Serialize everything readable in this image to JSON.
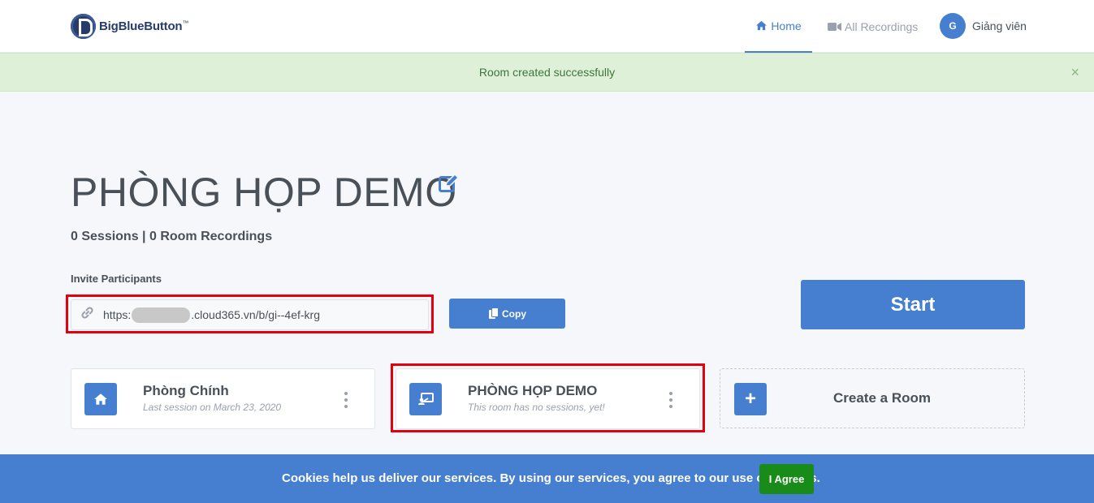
{
  "header": {
    "logo_text": "BigBlueButton",
    "logo_tm": "™",
    "nav": {
      "home_label": "Home",
      "recordings_label": "All Recordings"
    },
    "user": {
      "initial": "G",
      "name": "Giảng viên"
    }
  },
  "alert": {
    "message": "Room created successfully",
    "close": "×"
  },
  "room": {
    "title": "PHÒNG HỌP DEMO",
    "stats": "0 Sessions | 0 Room Recordings",
    "invite_label": "Invite Participants",
    "invite_url_prefix": "https:",
    "invite_url_suffix": ".cloud365.vn/b/gi--4ef-krg",
    "copy_label": "Copy",
    "start_label": "Start"
  },
  "rooms": [
    {
      "title": "Phòng Chính",
      "subtitle": "Last session on March 23, 2020",
      "icon": "home-icon"
    },
    {
      "title": "PHÒNG HỌP DEMO",
      "subtitle": "This room has no sessions, yet!",
      "icon": "presentation-icon"
    }
  ],
  "create_room": {
    "plus": "+",
    "label": "Create a Room"
  },
  "cookie": {
    "message": "Cookies help us deliver our services. By using our services, you agree to our use of cookies.",
    "agree_label": "I Agree"
  },
  "colors": {
    "primary": "#467fcf",
    "success_bg": "#dff0d8",
    "highlight": "#e3000f",
    "agree": "#198b18"
  }
}
